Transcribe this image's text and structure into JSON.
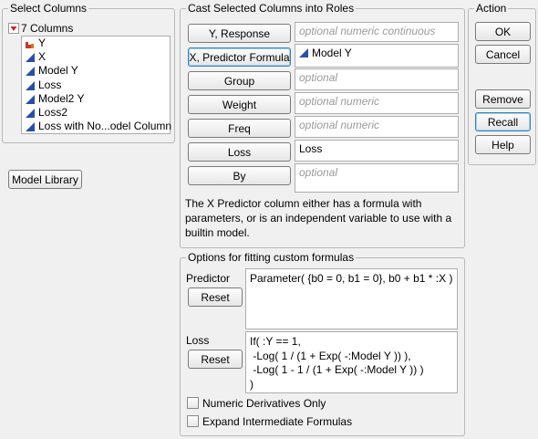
{
  "select_columns": {
    "title": "Select Columns",
    "count_label": "7 Columns",
    "items": [
      {
        "label": "Y",
        "icon": "nominal-bar-icon"
      },
      {
        "label": "X",
        "icon": "continuous-triangle-icon"
      },
      {
        "label": "Model Y",
        "icon": "continuous-triangle-icon"
      },
      {
        "label": "Loss",
        "icon": "continuous-triangle-icon"
      },
      {
        "label": "Model2 Y",
        "icon": "continuous-triangle-icon"
      },
      {
        "label": "Loss2",
        "icon": "continuous-triangle-icon"
      },
      {
        "label": "Loss with No...odel Column",
        "icon": "continuous-triangle-icon"
      }
    ]
  },
  "model_library_label": "Model Library",
  "cast": {
    "title": "Cast Selected Columns into Roles",
    "roles": [
      {
        "label": "Y, Response",
        "value": "",
        "placeholder": "optional numeric continuous"
      },
      {
        "label": "X, Predictor Formula",
        "value": "Model Y",
        "placeholder": ""
      },
      {
        "label": "Group",
        "value": "",
        "placeholder": "optional"
      },
      {
        "label": "Weight",
        "value": "",
        "placeholder": "optional numeric"
      },
      {
        "label": "Freq",
        "value": "",
        "placeholder": "optional numeric"
      },
      {
        "label": "Loss",
        "value": "Loss",
        "placeholder": ""
      },
      {
        "label": "By",
        "value": "",
        "placeholder": "optional"
      }
    ],
    "note": "The X Predictor column either has a formula with parameters, or is an independent variable to use with a builtin model."
  },
  "action": {
    "title": "Action",
    "ok": "OK",
    "cancel": "Cancel",
    "remove": "Remove",
    "recall": "Recall",
    "help": "Help"
  },
  "options": {
    "title": "Options for fitting custom formulas",
    "predictor_label": "Predictor",
    "predictor_reset": "Reset",
    "predictor_formula": "Parameter( {b0 = 0, b1 = 0}, b0 + b1 * :X )",
    "loss_label": "Loss",
    "loss_reset": "Reset",
    "loss_formula": "If( :Y == 1,\n -Log( 1 / (1 + Exp( -:Model Y )) ),\n -Log( 1 - 1 / (1 + Exp( -:Model Y )) )\n)",
    "numeric_derivatives": "Numeric Derivatives Only",
    "expand_intermediate": "Expand Intermediate Formulas"
  },
  "colors": {
    "continuous_icon": "#2a4ea8",
    "nominal_icon": "#c0392b",
    "disclosure": "#d22020"
  }
}
